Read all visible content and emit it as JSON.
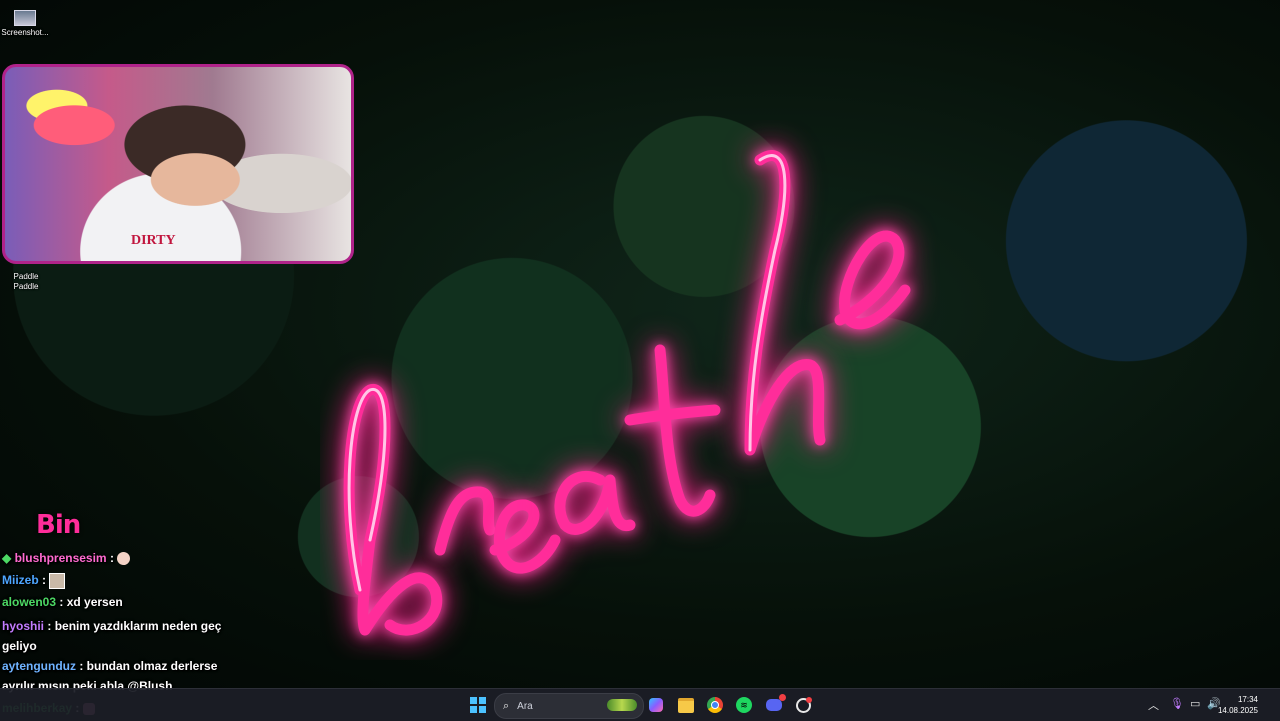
{
  "desktop": {
    "icons": [
      {
        "label": "Screenshot..."
      },
      {
        "label": "Paddle\nPaddle"
      }
    ]
  },
  "webcam": {
    "shirt_text": "DIRTY"
  },
  "chat": {
    "logo": "Bin",
    "messages": [
      {
        "user": "blushprensesim",
        "text": "",
        "user_color": "#ff6bd0",
        "prefix": "diamond",
        "emote": "face"
      },
      {
        "user": "Miizeb",
        "text": "",
        "user_color": "#4da6ff",
        "emote": "image"
      },
      {
        "user": "alowen03",
        "text": "xd yersen",
        "user_color": "#4cd964"
      },
      {
        "user": "hyoshii",
        "text": "benim yazdıklarım neden geç geliyo",
        "user_color": "#c27cff"
      },
      {
        "user": "aytengunduz",
        "text": "bundan olmaz derlerse ayrılır mısın peki abla @Blush",
        "user_color": "#6fb3ff"
      },
      {
        "user": "melihberkay",
        "text": "",
        "user_color": "#4cd964",
        "emote": "pink"
      }
    ]
  },
  "taskbar": {
    "search_placeholder": "Ara",
    "pinned": [
      {
        "name": "start",
        "icon": "windows-logo"
      },
      {
        "name": "copilot",
        "icon": "copilot-icon"
      },
      {
        "name": "file-explorer",
        "icon": "folder-icon"
      },
      {
        "name": "chrome",
        "icon": "chrome-icon"
      },
      {
        "name": "spotify",
        "icon": "spotify-icon"
      },
      {
        "name": "discord",
        "icon": "discord-icon"
      },
      {
        "name": "obs",
        "icon": "obs-icon"
      }
    ],
    "clock": {
      "time": "17:34",
      "date": "14.08.2025"
    }
  },
  "colors": {
    "neon": "#ff2d9a",
    "taskbar": "#1c1e26",
    "accent_blue": "#0078d4"
  }
}
